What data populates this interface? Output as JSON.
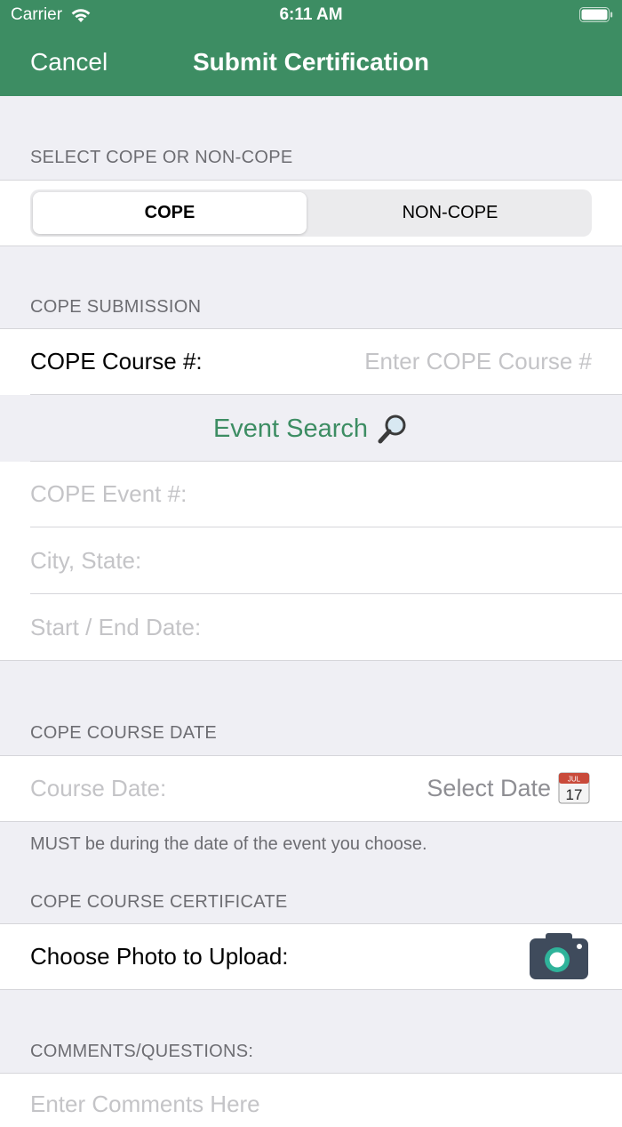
{
  "status": {
    "carrier": "Carrier",
    "time": "6:11 AM"
  },
  "nav": {
    "cancel": "Cancel",
    "title": "Submit Certification"
  },
  "select_section": {
    "header": "SELECT COPE OR NON-COPE",
    "options": [
      "COPE",
      "NON-COPE"
    ],
    "selected": "COPE"
  },
  "cope_submission": {
    "header": "COPE SUBMISSION",
    "course_label": "COPE Course #:",
    "course_placeholder": "Enter COPE Course #",
    "event_search": "Event Search",
    "event_label": "COPE Event #:",
    "city_label": "City, State:",
    "dates_label": "Start / End Date:"
  },
  "course_date": {
    "header": "COPE COURSE DATE",
    "label": "Course Date:",
    "select": "Select Date",
    "calendar_month": "JUL",
    "calendar_day": "17",
    "hint": "MUST be during the date of the event you choose."
  },
  "certificate": {
    "header": "COPE COURSE CERTIFICATE",
    "label": "Choose Photo to Upload:"
  },
  "comments": {
    "header": "COMMENTS/QUESTIONS:",
    "placeholder": "Enter Comments Here"
  },
  "colors": {
    "accent": "#3d8d63",
    "background": "#efeff4"
  },
  "icons": [
    "wifi-icon",
    "battery-icon",
    "magnifier-icon",
    "calendar-icon",
    "camera-icon"
  ]
}
